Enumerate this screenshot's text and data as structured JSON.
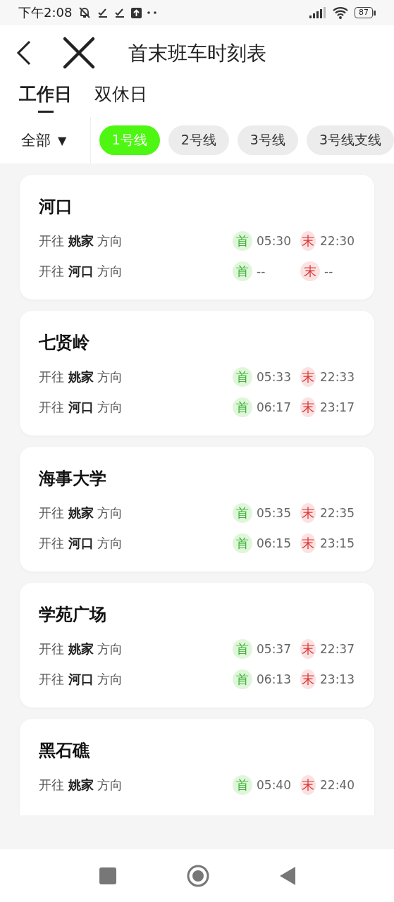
{
  "status_bar": {
    "time": "下午2:08",
    "battery": "87"
  },
  "header": {
    "title": "首末班车时刻表"
  },
  "day_tabs": [
    {
      "label": "工作日",
      "selected": true
    },
    {
      "label": "双休日",
      "selected": false
    }
  ],
  "filter": {
    "label": "全部",
    "caret": "▼"
  },
  "lines": [
    {
      "label": "1号线",
      "selected": true
    },
    {
      "label": "2号线",
      "selected": false
    },
    {
      "label": "3号线",
      "selected": false
    },
    {
      "label": "3号线支线",
      "selected": false
    }
  ],
  "stations": [
    {
      "name": "河口",
      "rows": [
        {
          "direction": "开往 **姚家** 方向",
          "times": [
            {
              "kind": "first",
              "badge": "首",
              "time": "05:30"
            },
            {
              "kind": "last",
              "badge": "末",
              "time": "22:30"
            }
          ]
        },
        {
          "direction": "开往 **河口** 方向",
          "times": [
            {
              "kind": "first",
              "badge": "首",
              "time": "--"
            },
            {
              "kind": "last",
              "badge": "末",
              "time": "--"
            }
          ]
        }
      ]
    },
    {
      "name": "七贤岭",
      "rows": [
        {
          "direction": "开往 **姚家** 方向",
          "times": [
            {
              "kind": "first",
              "badge": "首",
              "time": "05:33"
            },
            {
              "kind": "last",
              "badge": "末",
              "time": "22:33"
            }
          ]
        },
        {
          "direction": "开往 **河口** 方向",
          "times": [
            {
              "kind": "first",
              "badge": "首",
              "time": "06:17"
            },
            {
              "kind": "last",
              "badge": "末",
              "time": "23:17"
            }
          ]
        }
      ]
    },
    {
      "name": "海事大学",
      "rows": [
        {
          "direction": "开往 **姚家** 方向",
          "times": [
            {
              "kind": "first",
              "badge": "首",
              "time": "05:35"
            },
            {
              "kind": "last",
              "badge": "末",
              "time": "22:35"
            }
          ]
        },
        {
          "direction": "开往 **河口** 方向",
          "times": [
            {
              "kind": "first",
              "badge": "首",
              "time": "06:15"
            },
            {
              "kind": "last",
              "badge": "末",
              "time": "23:15"
            }
          ]
        }
      ]
    },
    {
      "name": "学苑广场",
      "rows": [
        {
          "direction": "开往 **姚家** 方向",
          "times": [
            {
              "kind": "first",
              "badge": "首",
              "time": "05:37"
            },
            {
              "kind": "last",
              "badge": "末",
              "time": "22:37"
            }
          ]
        },
        {
          "direction": "开往 **河口** 方向",
          "times": [
            {
              "kind": "first",
              "badge": "首",
              "time": "06:13"
            },
            {
              "kind": "last",
              "badge": "末",
              "time": "23:13"
            }
          ]
        }
      ]
    },
    {
      "name": "黑石礁",
      "rows": [
        {
          "direction": "开往 **姚家** 方向",
          "times": [
            {
              "kind": "first",
              "badge": "首",
              "time": "05:40"
            },
            {
              "kind": "last",
              "badge": "末",
              "time": "22:40"
            }
          ]
        }
      ]
    }
  ]
}
